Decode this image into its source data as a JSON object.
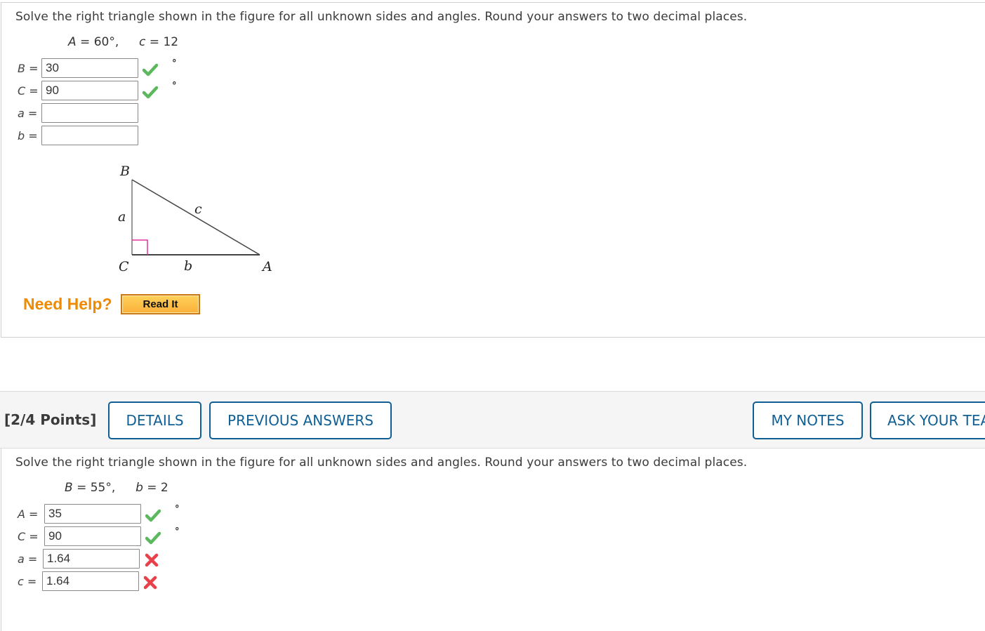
{
  "q1": {
    "prompt": "Solve the right triangle shown in the figure for all unknown sides and angles. Round your answers to two decimal places.",
    "given": {
      "var1": "A",
      "val1": " = 60°,",
      "var2": "c",
      "val2": " = 12"
    },
    "fields": [
      {
        "var": "B",
        "eq": " =",
        "value": "30",
        "status": "correct",
        "unit": "°"
      },
      {
        "var": "C",
        "eq": " =",
        "value": "90",
        "status": "correct",
        "unit": "°"
      },
      {
        "var": "a",
        "eq": " =",
        "value": "",
        "status": "",
        "unit": ""
      },
      {
        "var": "b",
        "eq": " =",
        "value": "",
        "status": "",
        "unit": ""
      }
    ],
    "figure": {
      "B": "B",
      "C": "C",
      "A": "A",
      "a": "a",
      "b": "b",
      "c": "c"
    },
    "need_help": "Need Help?",
    "read_it": "Read It"
  },
  "q2_bar": {
    "points": "[2/4 Points]",
    "details": "DETAILS",
    "previous_answers": "PREVIOUS ANSWERS",
    "my_notes": "MY NOTES",
    "ask_teacher": "ASK YOUR TEACHER"
  },
  "q2": {
    "prompt": "Solve the right triangle shown in the figure for all unknown sides and angles. Round your answers to two decimal places.",
    "given": {
      "var1": "B",
      "val1": " = 55°,",
      "var2": "b",
      "val2": " = 2"
    },
    "fields": [
      {
        "var": "A",
        "eq": " =",
        "value": "35",
        "status": "correct",
        "unit": "°"
      },
      {
        "var": "C",
        "eq": " =",
        "value": "90",
        "status": "correct",
        "unit": "°"
      },
      {
        "var": "a",
        "eq": " =",
        "value": "1.64",
        "status": "incorrect",
        "unit": ""
      },
      {
        "var": "c",
        "eq": " =",
        "value": "1.64",
        "status": "incorrect",
        "unit": ""
      }
    ]
  },
  "colors": {
    "correct": "#5cb85c",
    "incorrect": "#e8414a",
    "accent": "#0f5f95",
    "help": "#f08a00"
  }
}
